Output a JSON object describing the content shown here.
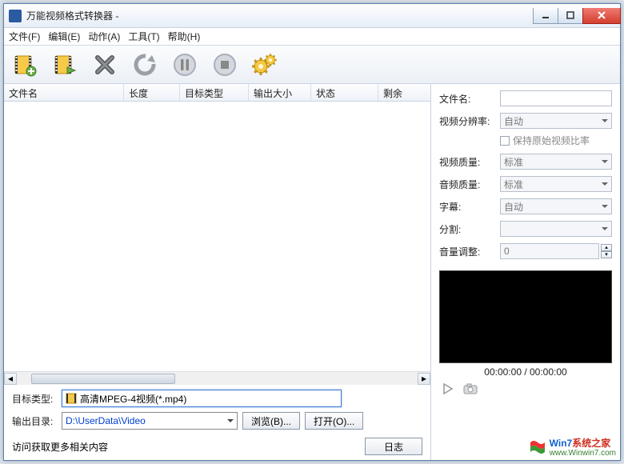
{
  "window": {
    "title": "万能视频格式转换器 -"
  },
  "menu": {
    "file": "文件(F)",
    "edit": "编辑(E)",
    "action": "动作(A)",
    "tools": "工具(T)",
    "help": "帮助(H)"
  },
  "columns": {
    "filename": "文件名",
    "length": "长度",
    "target_type": "目标类型",
    "output_size": "输出大小",
    "status": "状态",
    "remaining": "剩余"
  },
  "col_widths": {
    "filename": 150,
    "length": 70,
    "target_type": 86,
    "output_size": 78,
    "status": 84,
    "remaining": 56
  },
  "target_type": {
    "label": "目标类型:",
    "value": "高清MPEG-4视频(*.mp4)"
  },
  "output_dir": {
    "label": "输出目录:",
    "value": "D:\\UserData\\Video"
  },
  "buttons": {
    "browse": "浏览(B)...",
    "open": "打开(O)...",
    "log": "日志"
  },
  "more_link": "访问获取更多相关内容",
  "props": {
    "filename_label": "文件名:",
    "resolution_label": "视频分辨率:",
    "resolution_value": "自动",
    "keep_ratio": "保持原始视频比率",
    "vquality_label": "视频质量:",
    "vquality_value": "标准",
    "aquality_label": "音频质量:",
    "aquality_value": "标准",
    "subtitle_label": "字幕:",
    "subtitle_value": "自动",
    "split_label": "分割:",
    "split_value": "",
    "volume_label": "音量调整:",
    "volume_value": "0"
  },
  "timecode": "00:00:00 / 00:00:00",
  "watermark": {
    "brand1": "Win7",
    "brand2": "系统之家",
    "url": "www.Winwin7.com"
  }
}
